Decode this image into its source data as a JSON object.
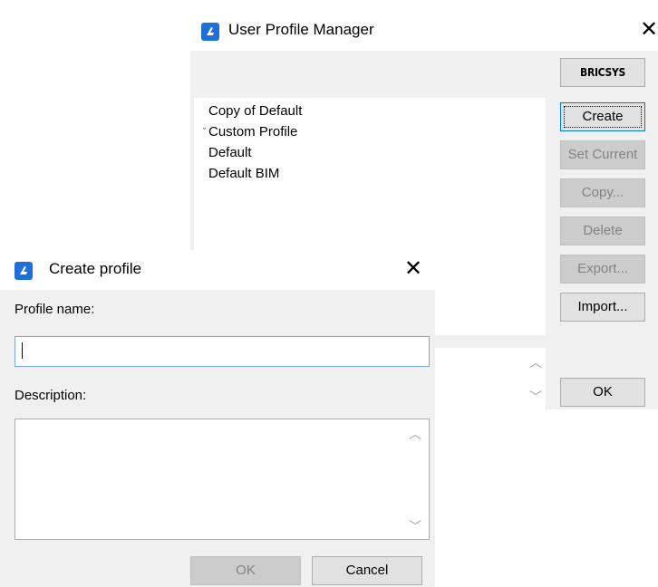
{
  "profile_manager": {
    "title": "User Profile Manager",
    "logo_text": "BRICSYS",
    "profiles": [
      {
        "name": "Copy of Default",
        "current": false
      },
      {
        "name": "Custom Profile",
        "current": true
      },
      {
        "name": "Default",
        "current": false
      },
      {
        "name": "Default BIM",
        "current": false
      }
    ],
    "current_mark": "ˇ",
    "buttons": {
      "create": "Create",
      "set_current": "Set Current",
      "copy": "Copy...",
      "delete": "Delete",
      "export": "Export...",
      "import": "Import...",
      "ok": "OK"
    }
  },
  "create_profile": {
    "title": "Create profile",
    "profile_name_label": "Profile name:",
    "profile_name_value": "",
    "description_label": "Description:",
    "description_value": "",
    "buttons": {
      "ok": "OK",
      "cancel": "Cancel"
    }
  },
  "icons": {
    "app": "bricscad-app-icon",
    "close": "close-icon",
    "scroll_up": "scroll-up-arrow-icon",
    "scroll_down": "scroll-down-arrow-icon"
  },
  "colors": {
    "app_icon": "#1e6fd9",
    "focus_border": "#0078d7",
    "disabled_text": "#838383"
  }
}
